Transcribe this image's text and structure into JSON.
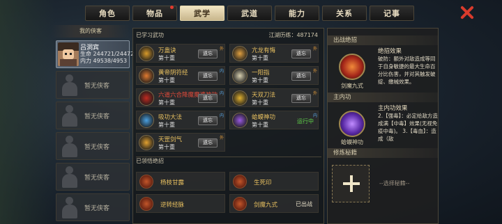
{
  "tabs": [
    {
      "label": "角色",
      "active": false,
      "badge": false
    },
    {
      "label": "物品",
      "active": false,
      "badge": true
    },
    {
      "label": "武学",
      "active": true,
      "badge": false
    },
    {
      "label": "武道",
      "active": false,
      "badge": false
    },
    {
      "label": "能力",
      "active": false,
      "badge": false
    },
    {
      "label": "关系",
      "active": false,
      "badge": false
    },
    {
      "label": "记事",
      "active": false,
      "badge": false
    }
  ],
  "left": {
    "title": "我的侠客",
    "selected": {
      "name": "吕洞宾",
      "hp_label": "生命",
      "hp": "244721/24472",
      "mp_label": "内力",
      "mp": "49538/4953"
    },
    "empty_label": "暂无侠客"
  },
  "mid": {
    "learned_header": "已学习武功",
    "jianghu": "江湖历练：487174",
    "forget_label": "遗忘",
    "running_label": "运行中",
    "skills": [
      {
        "name": "万蛊诀",
        "level": "第十重",
        "tag": "外",
        "red": false,
        "action": "遗忘",
        "icon_color": "#d89a2a"
      },
      {
        "name": "亢龙有悔",
        "level": "第十重",
        "tag": "外",
        "red": false,
        "action": "遗忘",
        "icon_color": "#e0a040"
      },
      {
        "name": "黄帝阴符经",
        "level": "第十重",
        "tag": "内",
        "red": false,
        "action": "遗忘",
        "icon_color": "#e07a30"
      },
      {
        "name": "一阳指",
        "level": "第十重",
        "tag": "外",
        "red": false,
        "action": "遗忘",
        "icon_color": "#d8d0b0"
      },
      {
        "name": "六道六合降魔魔婆神功",
        "level": "第十重",
        "tag": "内",
        "red": true,
        "action": "遗忘",
        "icon_color": "#c02a20"
      },
      {
        "name": "天双刀法",
        "level": "第十重",
        "tag": "外",
        "red": false,
        "action": "遗忘",
        "icon_color": "#e0b030"
      },
      {
        "name": "吸功大法",
        "level": "第十重",
        "tag": "内",
        "red": false,
        "action": "遗忘",
        "icon_color": "#4aa0e0"
      },
      {
        "name": "蛤蟆神功",
        "level": "第十重",
        "tag": "内",
        "red": false,
        "action": "运行中",
        "icon_color": "#9a5ae0"
      },
      {
        "name": "天罡剑气",
        "level": "第十重",
        "tag": "外",
        "red": false,
        "action": "遗忘",
        "icon_color": "#e0a030"
      }
    ],
    "moves_header": "已领悟绝招",
    "moves": [
      {
        "name": "杨枝甘露",
        "status": ""
      },
      {
        "name": "生死印",
        "status": ""
      },
      {
        "name": "逆转经脉",
        "status": ""
      },
      {
        "name": "剑魔九式",
        "status": "已出战"
      }
    ]
  },
  "right": {
    "battle_header": "出战绝招",
    "battle_move": "剑魔九式",
    "battle_title": "绝招效果",
    "battle_text": "破防：额外对敌造成等同于自身敏捷的最大生命百分比伤害，并对其触发破绽、缴械效果。",
    "main_header": "主内功",
    "main_skill": "蛤蟆神功",
    "main_title": "主内功效果",
    "main_text": "2.【强毒】：必定给敌方造成满【中毒】效果(无视免疫中毒)。 3.【毒血】：造成（敌",
    "cultivate_header": "修炼秘籍",
    "choose_label": "--选择秘籍--"
  }
}
